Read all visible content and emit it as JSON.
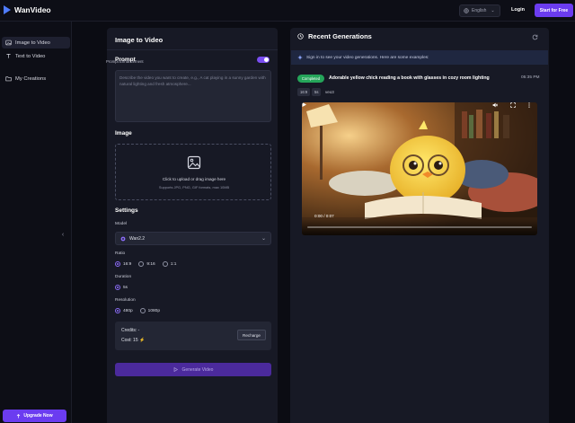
{
  "header": {
    "brand": "WanVideo",
    "language": "English",
    "login_label": "Login",
    "start_label": "Start for Free"
  },
  "sidebar": {
    "items": [
      {
        "label": "Image to Video",
        "icon": "image-icon",
        "active": true
      },
      {
        "label": "Text to Video",
        "icon": "text-icon",
        "active": false
      },
      {
        "label": "My Creations",
        "icon": "folder-icon",
        "active": false
      }
    ],
    "upgrade_label": "Upgrade Now"
  },
  "form": {
    "title": "Image to Video",
    "prompt_title": "Prompt",
    "enhancement_label": "Prompt Enhancement",
    "enhancement_on": true,
    "prompt_placeholder": "Describe the video you want to create, e.g., A cat playing in a sunny garden with natural lighting and fresh atmosphere...",
    "image_title": "Image",
    "upload_text": "Click to upload or drag image here",
    "upload_sub": "Supports JPG, PNG, GIF formats, max 10MB",
    "settings_title": "Settings",
    "model_label": "Model",
    "model_value": "Wan2.2",
    "ratio_label": "Ratio",
    "ratios": [
      {
        "label": "16:9",
        "selected": true
      },
      {
        "label": "9:16",
        "selected": false
      },
      {
        "label": "1:1",
        "selected": false
      }
    ],
    "duration_label": "Duration",
    "durations": [
      {
        "label": "5s",
        "selected": true
      }
    ],
    "resolution_label": "Resolution",
    "resolutions": [
      {
        "label": "480p",
        "selected": true
      },
      {
        "label": "1080p",
        "selected": false
      }
    ],
    "credits_line": "Credits: -",
    "cost_line": "Cost: 15 ⚡",
    "recharge_label": "Recharge",
    "generate_label": "Generate Video"
  },
  "recent": {
    "title": "Recent Generations",
    "notice": "Sign in to see your video generations. Here are some examples:",
    "item": {
      "status": "Completed",
      "title": "Adorable yellow chick reading a book with glasses in cozy room lighting",
      "time": "05:35 PM",
      "tags": [
        "16:9",
        "5s"
      ],
      "model": "veo3",
      "video_time": "0:00 / 0:07"
    }
  },
  "colors": {
    "accent": "#6b3cf0",
    "panel": "#171925",
    "background": "#0b0c13",
    "success": "#25a55a"
  }
}
